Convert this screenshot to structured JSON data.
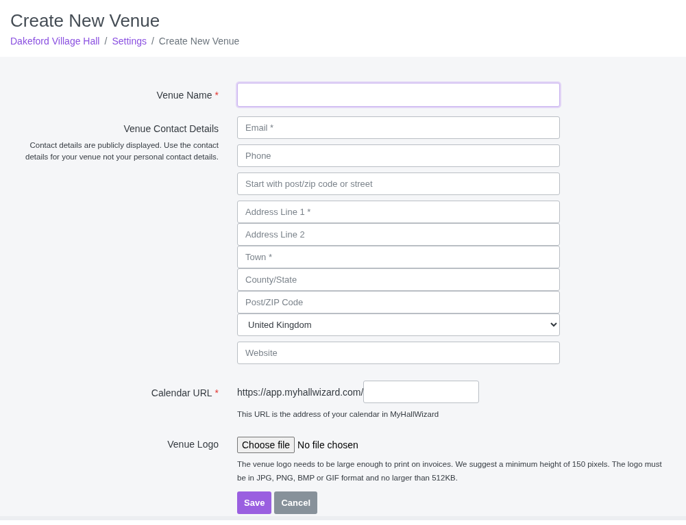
{
  "page": {
    "title": "Create New Venue"
  },
  "breadcrumbs": [
    {
      "label": "Dakeford Village Hall",
      "kind": "link"
    },
    {
      "separator": "/",
      "label": "Settings",
      "kind": "link"
    },
    {
      "separator": "/",
      "label": "Create New Venue",
      "kind": "current"
    }
  ],
  "venue_name": {
    "label": "Venue Name",
    "required_mark": "*",
    "focused": true
  },
  "contact": {
    "label": "Venue Contact Details",
    "note": "Contact details are publicly displayed. Use the contact details for your venue not your personal contact details.",
    "inputs": [
      {
        "kind": "single",
        "placeholder": "Email *"
      },
      {
        "kind": "single",
        "placeholder": "Phone"
      },
      {
        "kind": "single",
        "placeholder": "Start with post/zip code or street"
      },
      {
        "kind": "stacked",
        "placeholder": "Address Line 1 *"
      },
      {
        "kind": "stacked",
        "placeholder": "Address Line 2"
      },
      {
        "kind": "stacked",
        "placeholder": "Town *"
      },
      {
        "kind": "stacked",
        "placeholder": "County/State"
      },
      {
        "kind": "stacked",
        "placeholder": "Post/ZIP Code"
      },
      {
        "kind": "select",
        "value": "United Kingdom"
      },
      {
        "kind": "single",
        "placeholder": "Website"
      }
    ]
  },
  "calendar_url": {
    "label": "Calendar URL",
    "required_mark": "*",
    "prefix": "https://app.myhallwizard.com/",
    "help": "This URL is the address of your calendar in MyHallWizard"
  },
  "venue_logo": {
    "label": "Venue Logo",
    "button": "Choose file",
    "status": "No file chosen",
    "help": "The venue logo needs to be large enough to print on invoices. We suggest a minimum height of 150 pixels. The logo must be in JPG, PNG, BMP or GIF format and no larger than 512KB."
  },
  "buttons": [
    {
      "label": "Save",
      "kind": "primary"
    },
    {
      "label": "Cancel",
      "kind": "secondary"
    }
  ]
}
